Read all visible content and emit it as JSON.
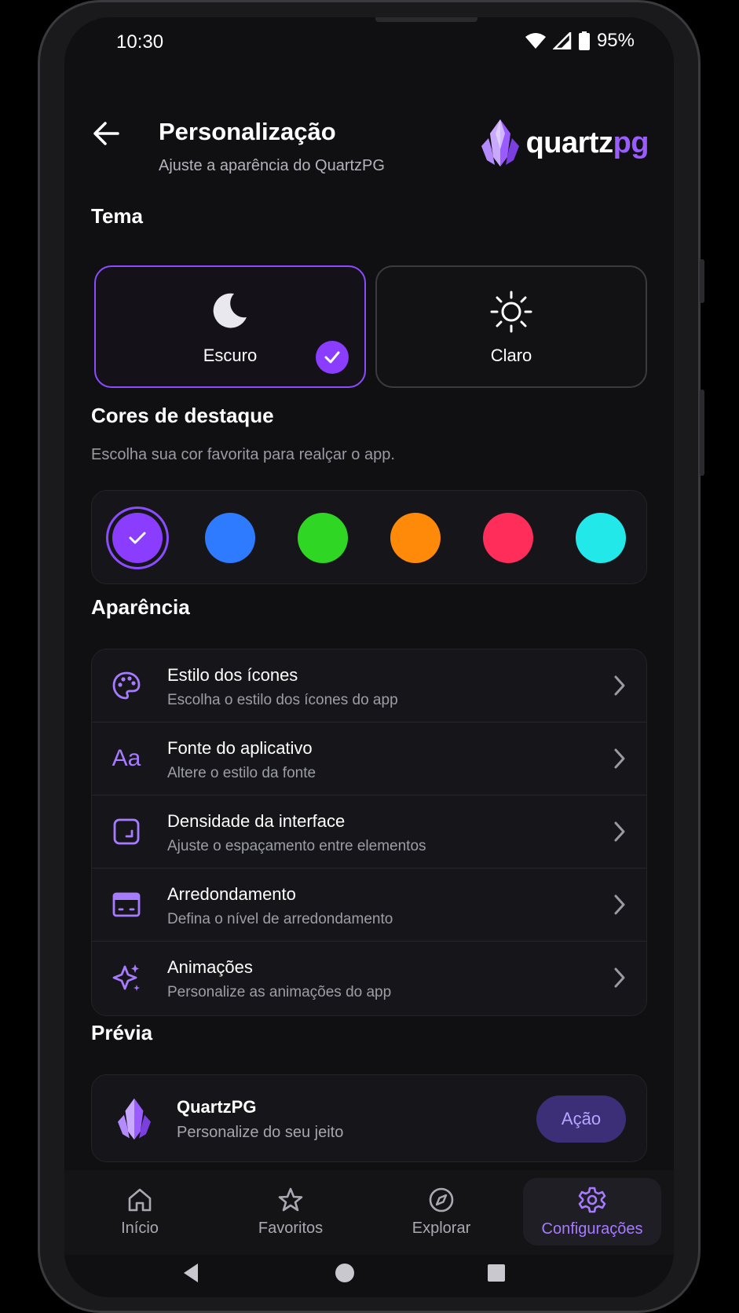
{
  "status_bar": {
    "time": "10:30",
    "battery": "95%"
  },
  "header": {
    "title": "Personalização",
    "subtitle": "Ajuste a aparência do QuartzPG",
    "logo_quartz": "quartz",
    "logo_pg": "pg"
  },
  "theme": {
    "section_title": "Tema",
    "options": [
      {
        "label": "Escuro",
        "icon": "moon-icon",
        "selected": true
      },
      {
        "label": "Claro",
        "icon": "sun-icon",
        "selected": false
      }
    ]
  },
  "accent": {
    "section_title": "Cores de destaque",
    "description": "Escolha sua cor favorita para realçar o app.",
    "colors": [
      "#8b3dff",
      "#2f7bff",
      "#2fd624",
      "#ff8a0a",
      "#ff2d5a",
      "#22e8ea"
    ],
    "selected_index": 0
  },
  "appearance": {
    "section_title": "Aparência",
    "items": [
      {
        "title": "Estilo dos ícones",
        "subtitle": "Escolha o estilo dos ícones do app",
        "icon": "palette-icon"
      },
      {
        "title": "Fonte do aplicativo",
        "subtitle": "Altere o estilo da fonte",
        "icon": "font-icon"
      },
      {
        "title": "Densidade da interface",
        "subtitle": "Ajuste o espaçamento entre elementos",
        "icon": "density-icon"
      },
      {
        "title": "Arredondamento",
        "subtitle": "Defina o nível de arredondamento",
        "icon": "rounded-card-icon"
      },
      {
        "title": "Animações",
        "subtitle": "Personalize as animações do app",
        "icon": "sparkle-icon"
      }
    ]
  },
  "preview": {
    "section_title": "Prévia",
    "app_name": "QuartzPG",
    "tagline": "Personalize do seu jeito",
    "action_label": "Ação"
  },
  "bottom_nav": {
    "items": [
      {
        "label": "Início",
        "icon": "home-icon",
        "active": false
      },
      {
        "label": "Favoritos",
        "icon": "star-icon",
        "active": false
      },
      {
        "label": "Explorar",
        "icon": "compass-icon",
        "active": false
      },
      {
        "label": "Configurações",
        "icon": "gear-icon",
        "active": true
      }
    ]
  },
  "colors": {
    "accent": "#8b3dff",
    "background": "#101013",
    "card": "#16161a"
  },
  "font_aa_glyph": "Aa"
}
